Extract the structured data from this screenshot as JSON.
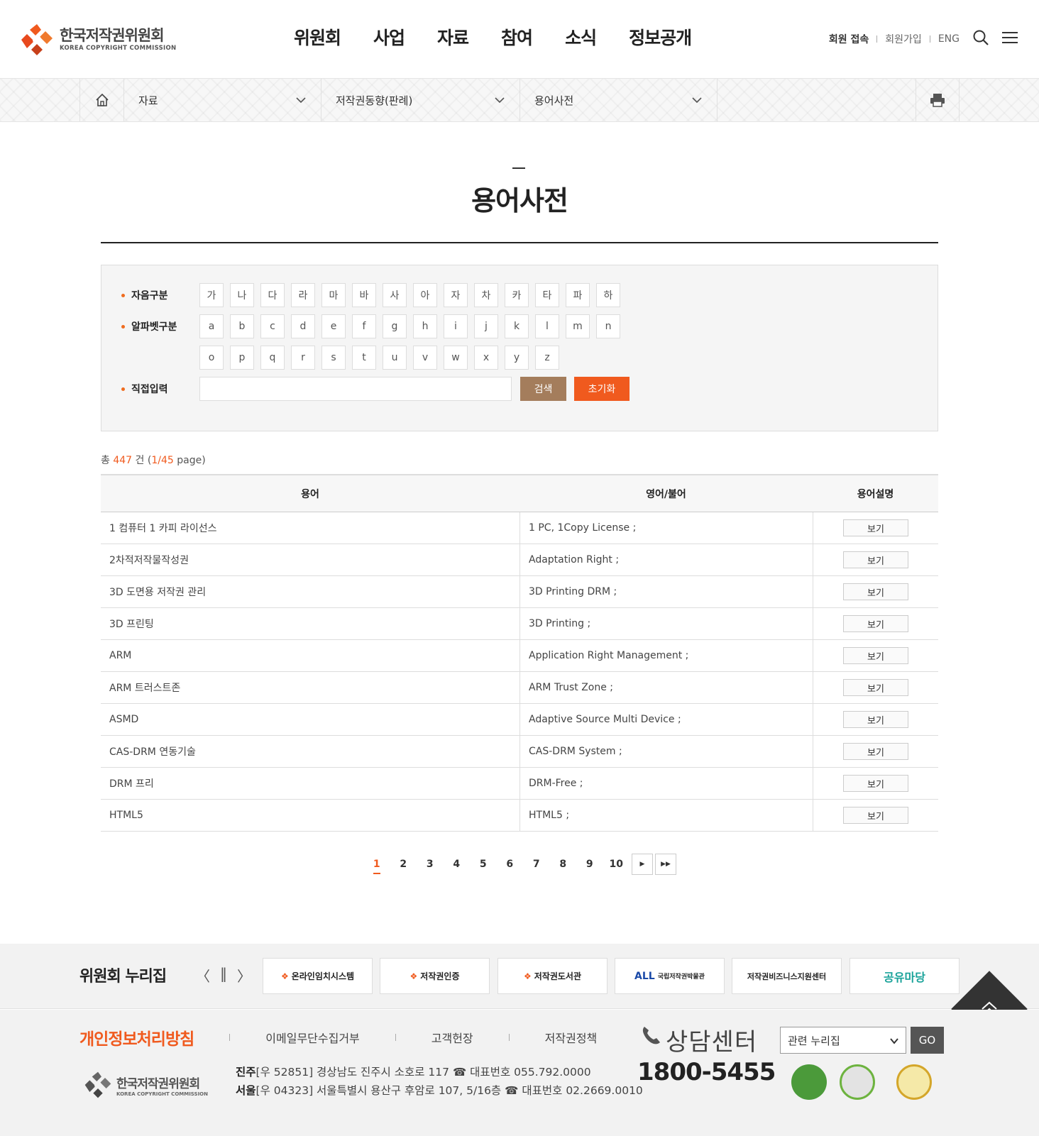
{
  "header": {
    "logo_ko": "한국저작권위원회",
    "logo_en": "KOREA COPYRIGHT COMMISSION",
    "nav": [
      "위원회",
      "사업",
      "자료",
      "참여",
      "소식",
      "정보공개"
    ],
    "util": {
      "login": "회원 접속",
      "join": "회원가입",
      "eng": "ENG"
    }
  },
  "location": {
    "level1": "자료",
    "level2": "저작권동향(판례)",
    "level3": "용어사전"
  },
  "page_title": "용어사전",
  "search": {
    "consonant_label": "자음구분",
    "consonants": [
      "가",
      "나",
      "다",
      "라",
      "마",
      "바",
      "사",
      "아",
      "자",
      "차",
      "카",
      "타",
      "파",
      "하"
    ],
    "alphabet_label": "알파벳구분",
    "alphabet_row1": [
      "a",
      "b",
      "c",
      "d",
      "e",
      "f",
      "g",
      "h",
      "i",
      "j",
      "k",
      "l",
      "m",
      "n"
    ],
    "alphabet_row2": [
      "o",
      "p",
      "q",
      "r",
      "s",
      "t",
      "u",
      "v",
      "w",
      "x",
      "y",
      "z"
    ],
    "direct_label": "직접입력",
    "input_value": "",
    "search_btn": "검색",
    "reset_btn": "초기화"
  },
  "count": {
    "prefix": "총 ",
    "total": "447",
    "unit": " 건 (",
    "page": "1/45",
    "suffix": " page)"
  },
  "table": {
    "headers": [
      "용어",
      "영어/불어",
      "용어설명"
    ],
    "view_label": "보기",
    "rows": [
      {
        "term": "1 컴퓨터 1 카피 라이선스",
        "foreign": "1 PC, 1Copy License ;"
      },
      {
        "term": "2차적저작물작성권",
        "foreign": "Adaptation Right ;"
      },
      {
        "term": "3D 도면용 저작권 관리",
        "foreign": "3D Printing DRM ;"
      },
      {
        "term": "3D 프린팅",
        "foreign": "3D Printing ;"
      },
      {
        "term": "ARM",
        "foreign": "Application Right Management ;"
      },
      {
        "term": "ARM 트러스트존",
        "foreign": "ARM Trust Zone ;"
      },
      {
        "term": "ASMD",
        "foreign": "Adaptive Source Multi Device ;"
      },
      {
        "term": "CAS-DRM 연동기술",
        "foreign": "CAS-DRM System ;"
      },
      {
        "term": "DRM 프리",
        "foreign": "DRM-Free ;"
      },
      {
        "term": "HTML5",
        "foreign": "HTML5 ;"
      }
    ]
  },
  "pagination": {
    "pages": [
      "1",
      "2",
      "3",
      "4",
      "5",
      "6",
      "7",
      "8",
      "9",
      "10"
    ],
    "current": "1"
  },
  "family": {
    "title": "위원회 누리집",
    "sites": [
      "온라인임치시스템",
      "저작권인증",
      "저작권도서관",
      "국립저작권박물관",
      "저작권비즈니스지원센터",
      "공유마당"
    ]
  },
  "footer": {
    "links": [
      "개인정보처리방침",
      "이메일무단수집거부",
      "고객헌장",
      "저작권정책"
    ],
    "logo_ko": "한국저작권위원회",
    "logo_en": "KOREA COPYRIGHT COMMISSION",
    "addr1_city": "진주",
    "addr1": "[우 52851] 경상남도 진주시 소호로 117 ☎ 대표번호 055.792.0000",
    "addr2_city": "서울",
    "addr2": "[우 04323] 서울특별시 용산구 후암로 107, 5/16층 ☎ 대표번호 02.2669.0010",
    "call_label": "상담센터",
    "call_number": "1800-5455",
    "related_select": "관련 누리집",
    "go_btn": "GO"
  },
  "colors": {
    "accent": "#f05a1e",
    "brown": "#a47d5c"
  }
}
